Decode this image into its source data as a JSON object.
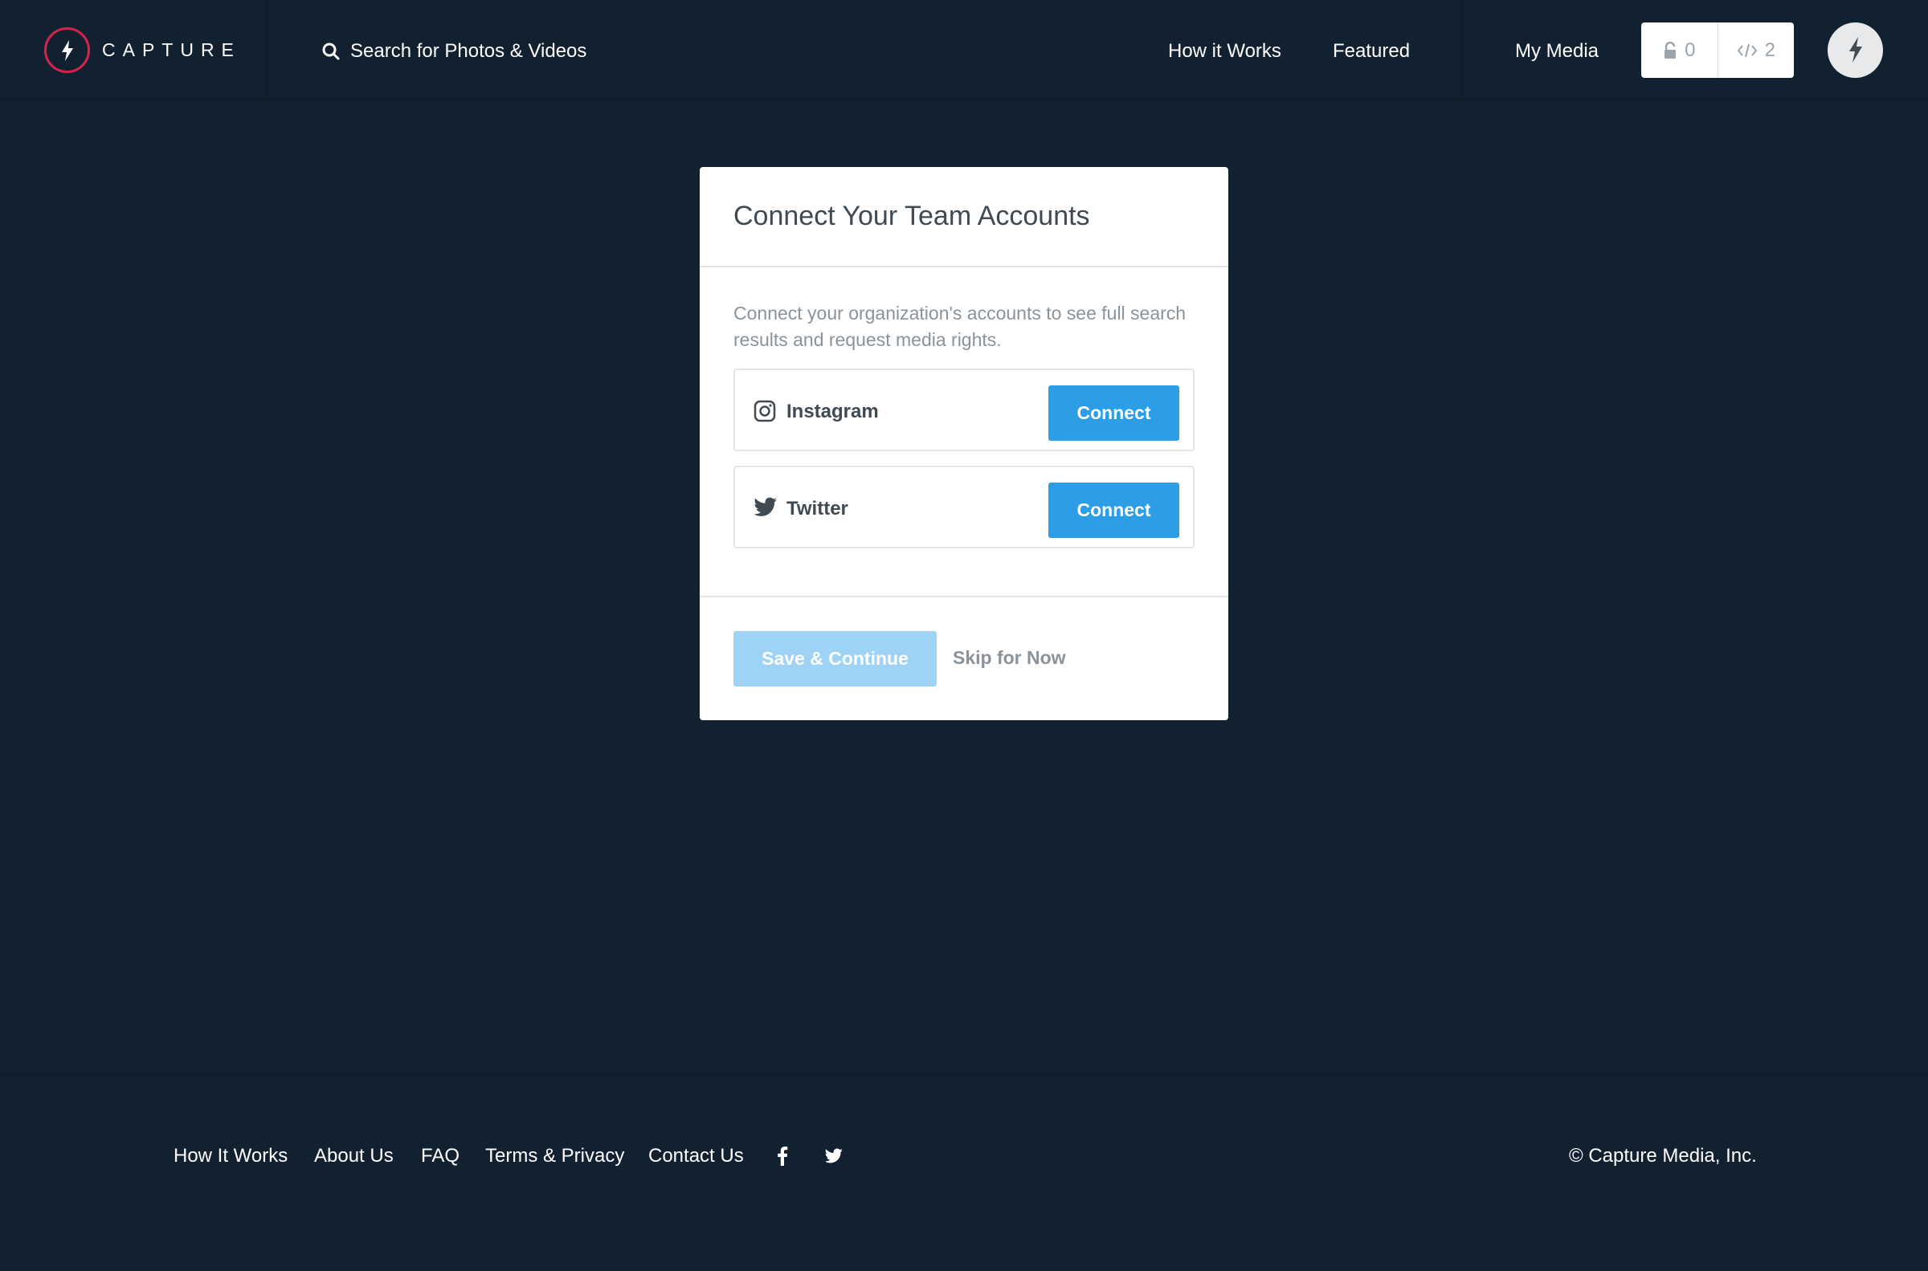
{
  "header": {
    "brand": "CAPTURE",
    "search_label": "Search for Photos & Videos",
    "nav": {
      "how_it_works": "How it Works",
      "featured": "Featured",
      "my_media": "My Media"
    },
    "counters": {
      "unlocked": "0",
      "embeds": "2"
    }
  },
  "modal": {
    "title": "Connect Your Team Accounts",
    "description": "Connect your organization's accounts to see full search results and request media rights.",
    "accounts": [
      {
        "name": "Instagram",
        "icon": "instagram-icon",
        "button": "Connect"
      },
      {
        "name": "Twitter",
        "icon": "twitter-icon",
        "button": "Connect"
      }
    ],
    "save_label": "Save & Continue",
    "skip_label": "Skip for Now"
  },
  "footer": {
    "links": [
      "How It Works",
      "About Us",
      "FAQ",
      "Terms & Privacy",
      "Contact Us"
    ],
    "copyright": "© Capture Media, Inc."
  },
  "colors": {
    "background": "#122130",
    "accent": "#2d9ee6",
    "accent_disabled": "#9fd3f5",
    "brand_red": "#d6234c"
  }
}
